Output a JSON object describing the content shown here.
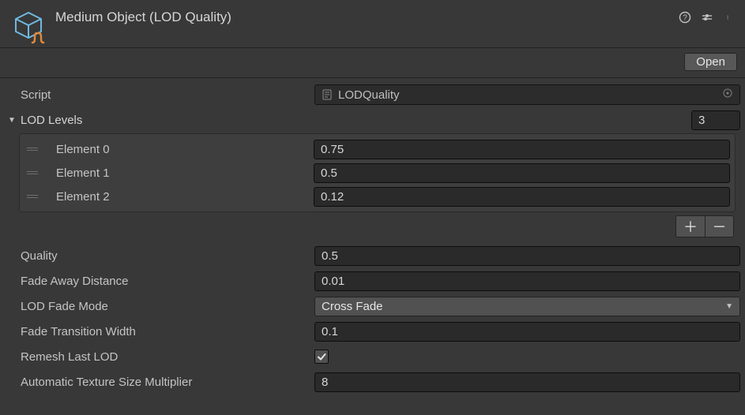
{
  "header": {
    "title": "Medium Object (LOD Quality)",
    "open_button": "Open"
  },
  "script_row": {
    "label": "Script",
    "value": "LODQuality"
  },
  "lod_levels": {
    "label": "LOD Levels",
    "count": "3",
    "elements": [
      {
        "label": "Element 0",
        "value": "0.75"
      },
      {
        "label": "Element 1",
        "value": "0.5"
      },
      {
        "label": "Element 2",
        "value": "0.12"
      }
    ]
  },
  "props": {
    "quality": {
      "label": "Quality",
      "value": "0.5"
    },
    "fade_away_distance": {
      "label": "Fade Away Distance",
      "value": "0.01"
    },
    "lod_fade_mode": {
      "label": "LOD Fade Mode",
      "value": "Cross Fade"
    },
    "fade_transition_width": {
      "label": "Fade Transition Width",
      "value": "0.1"
    },
    "remesh_last_lod": {
      "label": "Remesh Last LOD",
      "checked": true
    },
    "auto_tex_size_mult": {
      "label": "Automatic Texture Size Multiplier",
      "value": "8"
    }
  }
}
